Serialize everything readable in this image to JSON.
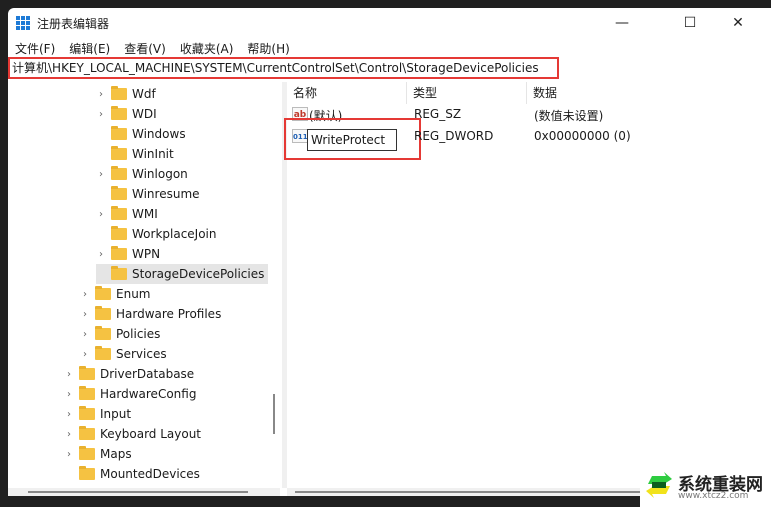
{
  "window": {
    "title": "注册表编辑器",
    "minimize": "—",
    "maximize": "☐",
    "close": "✕"
  },
  "menu": [
    "文件(F)",
    "编辑(E)",
    "查看(V)",
    "收藏夹(A)",
    "帮助(H)"
  ],
  "address": "计算机\\HKEY_LOCAL_MACHINE\\SYSTEM\\CurrentControlSet\\Control\\StorageDevicePolicies",
  "tree": [
    {
      "label": "Wdf",
      "level": 2,
      "expandable": true
    },
    {
      "label": "WDI",
      "level": 2,
      "expandable": true
    },
    {
      "label": "Windows",
      "level": 2,
      "expandable": false
    },
    {
      "label": "WinInit",
      "level": 2,
      "expandable": false
    },
    {
      "label": "Winlogon",
      "level": 2,
      "expandable": true
    },
    {
      "label": "Winresume",
      "level": 2,
      "expandable": false
    },
    {
      "label": "WMI",
      "level": 2,
      "expandable": true
    },
    {
      "label": "WorkplaceJoin",
      "level": 2,
      "expandable": false
    },
    {
      "label": "WPN",
      "level": 2,
      "expandable": true
    },
    {
      "label": "StorageDevicePolicies",
      "level": 2,
      "expandable": false,
      "selected": true
    },
    {
      "label": "Enum",
      "level": 1,
      "expandable": true
    },
    {
      "label": "Hardware Profiles",
      "level": 1,
      "expandable": true
    },
    {
      "label": "Policies",
      "level": 1,
      "expandable": true
    },
    {
      "label": "Services",
      "level": 1,
      "expandable": true
    },
    {
      "label": "DriverDatabase",
      "level": 0,
      "expandable": true
    },
    {
      "label": "HardwareConfig",
      "level": 0,
      "expandable": true
    },
    {
      "label": "Input",
      "level": 0,
      "expandable": true
    },
    {
      "label": "Keyboard Layout",
      "level": 0,
      "expandable": true
    },
    {
      "label": "Maps",
      "level": 0,
      "expandable": true
    },
    {
      "label": "MountedDevices",
      "level": 0,
      "expandable": false
    }
  ],
  "list": {
    "columns": [
      "名称",
      "类型",
      "数据"
    ],
    "rows": [
      {
        "icon": "ab",
        "name": "(默认)",
        "type": "REG_SZ",
        "data": "(数值未设置)"
      },
      {
        "icon": "011",
        "name": "WriteProtect",
        "type": "REG_DWORD",
        "data": "0x00000000 (0)",
        "editing": true
      }
    ]
  },
  "watermark": {
    "name": "系统重装网",
    "url": "www.xtcz2.com"
  }
}
